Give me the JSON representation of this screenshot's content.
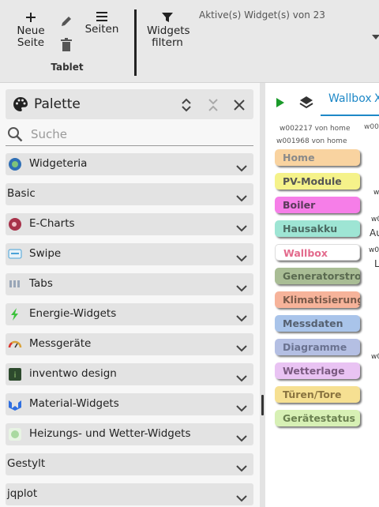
{
  "toolbar": {
    "new_page_label_1": "Neue",
    "new_page_label_2": "Seite",
    "pages_label": "Seiten",
    "group_label": "Tablet",
    "filter_label_1": "Widgets",
    "filter_label_2": "filtern",
    "status": "Aktive(s) Widget(s) von 23"
  },
  "palette": {
    "title": "Palette",
    "search_placeholder": "Suche",
    "categories": [
      {
        "label": "Widgeteria",
        "icon": "widgeteria-icon",
        "color": "#2f6fb5"
      },
      {
        "label": "Basic",
        "icon": "",
        "color": ""
      },
      {
        "label": "E-Charts",
        "icon": "echarts-icon",
        "color": "#a8324a"
      },
      {
        "label": "Swipe",
        "icon": "swipe-icon",
        "color": "#4aa3d8"
      },
      {
        "label": "Tabs",
        "icon": "tabs-icon",
        "color": "#9aa7b8"
      },
      {
        "label": "Energie-Widgets",
        "icon": "lightning-icon",
        "color": "#3cc23c"
      },
      {
        "label": "Messgeräte",
        "icon": "gauge-icon",
        "color": "#d9a23a"
      },
      {
        "label": "inventwo design",
        "icon": "inventwo-icon",
        "color": "#2d4a2d"
      },
      {
        "label": "Material-Widgets",
        "icon": "material-icon",
        "color": "#2f6fe0"
      },
      {
        "label": "Heizungs- und Wetter-Widgets",
        "icon": "weather-icon",
        "color": "#a9d9a0"
      },
      {
        "label": "Gestylt",
        "icon": "",
        "color": ""
      },
      {
        "label": "jqplot",
        "icon": "",
        "color": ""
      }
    ]
  },
  "view": {
    "tab_label": "Wallbox",
    "tab_more": "X",
    "top_fragment": "w00",
    "widget_line_1": "w002217 von home",
    "widget_line_2": "w001968 von home",
    "side_fragments": [
      "w",
      "w0",
      "Au",
      "w0",
      "L",
      "w0"
    ],
    "nav_buttons": [
      {
        "label": "Home",
        "bg": "#f9d3a0",
        "fg": "#8a8a8a"
      },
      {
        "label": "PV-Module",
        "bg": "#f5f28a",
        "fg": "#555555"
      },
      {
        "label": "Boiler",
        "bg": "#f67ee8",
        "fg": "#5a3a5a"
      },
      {
        "label": "Hausakku",
        "bg": "#9ee5d4",
        "fg": "#4a6a62"
      },
      {
        "label": "Wallbox",
        "bg": "#ffffff",
        "fg": "#e36a8c"
      },
      {
        "label": "Generatorstrom",
        "bg": "#a9bd95",
        "fg": "#5a6a50"
      },
      {
        "label": "Klimatisierung",
        "bg": "#f6b39a",
        "fg": "#7a5a4a"
      },
      {
        "label": "Messdaten",
        "bg": "#a9c4ea",
        "fg": "#556070"
      },
      {
        "label": "Diagramme",
        "bg": "#b4bfe3",
        "fg": "#6a7290"
      },
      {
        "label": "Wetterlage",
        "bg": "#e9c3f3",
        "fg": "#7a5a80"
      },
      {
        "label": "Türen/Tore",
        "bg": "#f6e092",
        "fg": "#8a7440"
      },
      {
        "label": "Gerätestatus",
        "bg": "#d7f0b5",
        "fg": "#6a8050"
      }
    ]
  }
}
